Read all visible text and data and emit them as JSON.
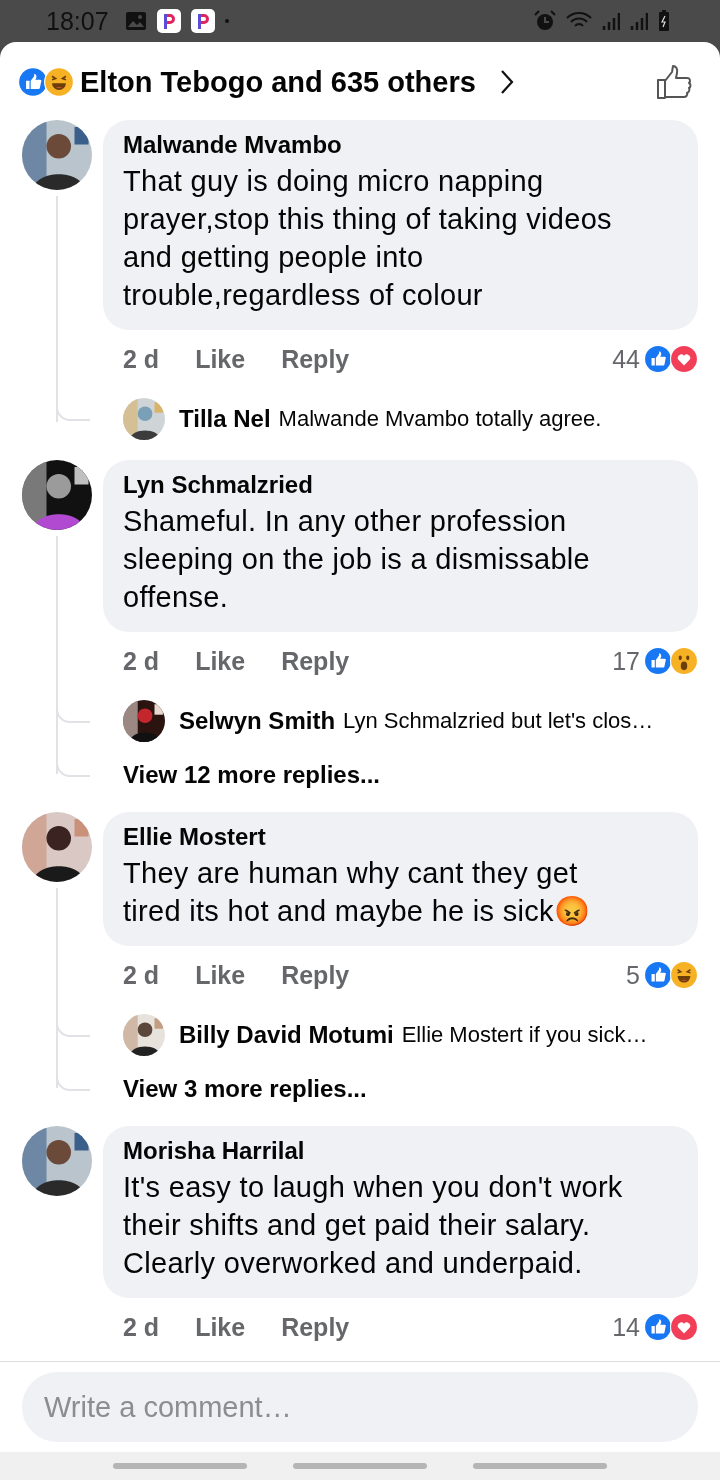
{
  "status_bar": {
    "time": "18:07"
  },
  "header": {
    "reactions": [
      {
        "kind": "like"
      },
      {
        "kind": "haha"
      }
    ],
    "title": "Elton Tebogo and 635 others"
  },
  "comments": [
    {
      "author": "Malwande Mvambo",
      "text": "That guy is doing micro napping prayer,stop this thing of taking videos and getting people into trouble,regardless of colour",
      "time": "2 d",
      "like": "Like",
      "reply": "Reply",
      "count": "44",
      "reactions": [
        {
          "kind": "like"
        },
        {
          "kind": "love"
        }
      ],
      "replies": [
        {
          "author": "Tilla Nel",
          "text": "Malwande Mvambo totally agree."
        }
      ]
    },
    {
      "author": "Lyn Schmalzried",
      "text": "Shameful. In any other profession sleeping on the job is a dismissable offense.",
      "time": "2 d",
      "like": "Like",
      "reply": "Reply",
      "count": "17",
      "reactions": [
        {
          "kind": "like"
        },
        {
          "kind": "wow"
        }
      ],
      "replies": [
        {
          "author": "Selwyn Smith",
          "text": "Lyn Schmalzried but let's clos…"
        }
      ],
      "more": "View 12 more replies..."
    },
    {
      "author": "Ellie Mostert",
      "text": "They are human why cant they get tired its hot and maybe he is sick😡",
      "time": "2 d",
      "like": "Like",
      "reply": "Reply",
      "count": "5",
      "reactions": [
        {
          "kind": "like"
        },
        {
          "kind": "haha"
        }
      ],
      "replies": [
        {
          "author": "Billy David Motumi",
          "text": "Ellie Mostert if you sick…"
        }
      ],
      "more": "View 3 more replies..."
    },
    {
      "author": "Morisha Harrilal",
      "text": "It's easy to laugh when you don't work their shifts and get paid their salary. Clearly overworked and underpaid.",
      "time": "2 d",
      "like": "Like",
      "reply": "Reply",
      "count": "14",
      "reactions": [
        {
          "kind": "like"
        },
        {
          "kind": "love"
        }
      ]
    }
  ],
  "composer": {
    "placeholder": "Write a comment…"
  }
}
